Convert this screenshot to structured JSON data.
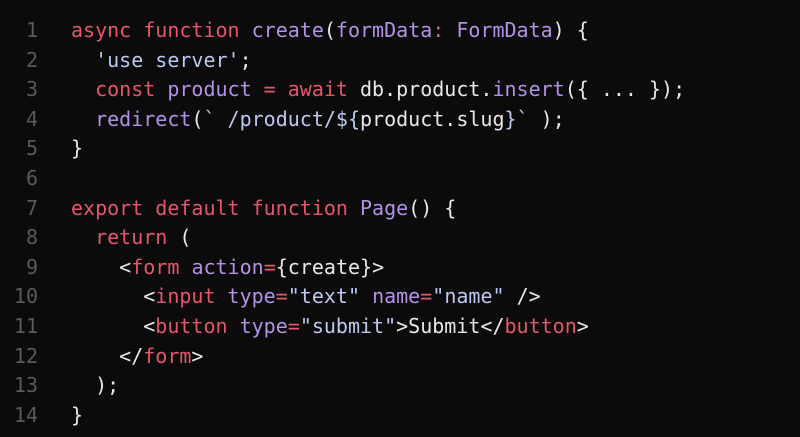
{
  "theme": {
    "background": "#0b0b0b",
    "line_number": "#5a5a5a",
    "default": "#e8e8e8",
    "keyword": "#e4566b",
    "function": "#b292e6",
    "string": "#bcc8f0",
    "punct": "#e8e8e8"
  },
  "lines": [
    {
      "n": "1",
      "tokens": [
        {
          "t": "async function ",
          "c": "keyword"
        },
        {
          "t": "create",
          "c": "function"
        },
        {
          "t": "(",
          "c": "punct"
        },
        {
          "t": "formData",
          "c": "function"
        },
        {
          "t": ": ",
          "c": "keyword"
        },
        {
          "t": "FormData",
          "c": "function"
        },
        {
          "t": ") {",
          "c": "punct"
        }
      ]
    },
    {
      "n": "2",
      "tokens": [
        {
          "t": "  ",
          "c": "punct"
        },
        {
          "t": "'use server'",
          "c": "string"
        },
        {
          "t": ";",
          "c": "punct"
        }
      ]
    },
    {
      "n": "3",
      "tokens": [
        {
          "t": "  ",
          "c": "punct"
        },
        {
          "t": "const ",
          "c": "keyword"
        },
        {
          "t": "product",
          "c": "function"
        },
        {
          "t": " = ",
          "c": "keyword"
        },
        {
          "t": "await ",
          "c": "keyword"
        },
        {
          "t": "db.product.",
          "c": "default"
        },
        {
          "t": "insert",
          "c": "function"
        },
        {
          "t": "({ ... });",
          "c": "punct"
        }
      ]
    },
    {
      "n": "4",
      "tokens": [
        {
          "t": "  ",
          "c": "punct"
        },
        {
          "t": "redirect",
          "c": "function"
        },
        {
          "t": "(",
          "c": "punct"
        },
        {
          "t": "` /product/${",
          "c": "string"
        },
        {
          "t": "product.slug",
          "c": "default"
        },
        {
          "t": "}`",
          "c": "string"
        },
        {
          "t": " );",
          "c": "punct"
        }
      ]
    },
    {
      "n": "5",
      "tokens": [
        {
          "t": "}",
          "c": "punct"
        }
      ]
    },
    {
      "n": "6",
      "tokens": []
    },
    {
      "n": "7",
      "tokens": [
        {
          "t": "export default function ",
          "c": "keyword"
        },
        {
          "t": "Page",
          "c": "function"
        },
        {
          "t": "() {",
          "c": "punct"
        }
      ]
    },
    {
      "n": "8",
      "tokens": [
        {
          "t": "  ",
          "c": "punct"
        },
        {
          "t": "return",
          "c": "keyword"
        },
        {
          "t": " (",
          "c": "punct"
        }
      ]
    },
    {
      "n": "9",
      "tokens": [
        {
          "t": "    <",
          "c": "punct"
        },
        {
          "t": "form ",
          "c": "keyword"
        },
        {
          "t": "action",
          "c": "function"
        },
        {
          "t": "=",
          "c": "keyword"
        },
        {
          "t": "{create}",
          "c": "punct"
        },
        {
          "t": ">",
          "c": "punct"
        }
      ]
    },
    {
      "n": "10",
      "tokens": [
        {
          "t": "      <",
          "c": "punct"
        },
        {
          "t": "input ",
          "c": "keyword"
        },
        {
          "t": "type",
          "c": "function"
        },
        {
          "t": "=",
          "c": "keyword"
        },
        {
          "t": "\"text\" ",
          "c": "string"
        },
        {
          "t": "name",
          "c": "function"
        },
        {
          "t": "=",
          "c": "keyword"
        },
        {
          "t": "\"name\"",
          "c": "string"
        },
        {
          "t": " />",
          "c": "punct"
        }
      ]
    },
    {
      "n": "11",
      "tokens": [
        {
          "t": "      <",
          "c": "punct"
        },
        {
          "t": "button ",
          "c": "keyword"
        },
        {
          "t": "type",
          "c": "function"
        },
        {
          "t": "=",
          "c": "keyword"
        },
        {
          "t": "\"submit\"",
          "c": "string"
        },
        {
          "t": ">Submit</",
          "c": "punct"
        },
        {
          "t": "button",
          "c": "keyword"
        },
        {
          "t": ">",
          "c": "punct"
        }
      ]
    },
    {
      "n": "12",
      "tokens": [
        {
          "t": "    </",
          "c": "punct"
        },
        {
          "t": "form",
          "c": "keyword"
        },
        {
          "t": ">",
          "c": "punct"
        }
      ]
    },
    {
      "n": "13",
      "tokens": [
        {
          "t": "  );",
          "c": "punct"
        }
      ]
    },
    {
      "n": "14",
      "tokens": [
        {
          "t": "}",
          "c": "punct"
        }
      ]
    }
  ]
}
